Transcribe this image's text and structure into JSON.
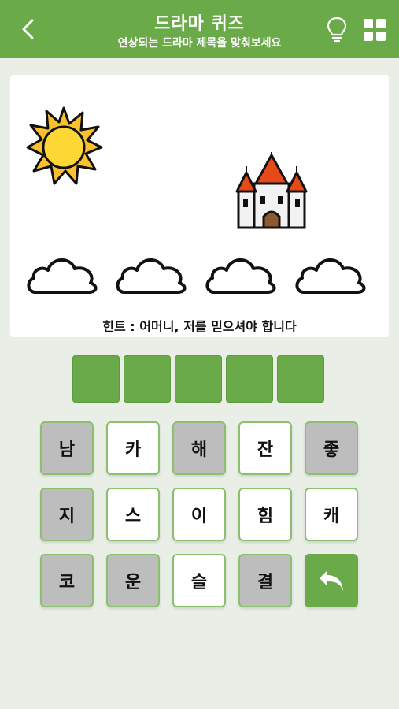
{
  "header": {
    "title": "드라마 퀴즈",
    "subtitle": "연상되는 드라마 제목을 맞춰보세요",
    "back_icon": "back-arrow-icon",
    "hint_icon": "lightbulb-icon",
    "menu_icon": "grid-menu-icon"
  },
  "puzzle": {
    "images": [
      "sun",
      "castle",
      "cloud",
      "cloud",
      "cloud",
      "cloud"
    ],
    "hint": "힌트 : 어머니, 저를 믿으셔야 합니다"
  },
  "answer": {
    "slot_count": 5,
    "slots": [
      "",
      "",
      "",
      "",
      ""
    ]
  },
  "keyboard": {
    "keys": [
      {
        "label": "남",
        "state": "used"
      },
      {
        "label": "카",
        "state": "available"
      },
      {
        "label": "해",
        "state": "used"
      },
      {
        "label": "잔",
        "state": "available"
      },
      {
        "label": "좋",
        "state": "used"
      },
      {
        "label": "지",
        "state": "used"
      },
      {
        "label": "스",
        "state": "available"
      },
      {
        "label": "이",
        "state": "available"
      },
      {
        "label": "힘",
        "state": "available"
      },
      {
        "label": "캐",
        "state": "available"
      },
      {
        "label": "코",
        "state": "used"
      },
      {
        "label": "운",
        "state": "used"
      },
      {
        "label": "슬",
        "state": "available"
      },
      {
        "label": "결",
        "state": "used"
      }
    ],
    "undo_icon": "undo-arrow-icon"
  },
  "colors": {
    "accent": "#6aaa48",
    "background": "#e9efe6",
    "used_key": "#bdbdbd",
    "available_key": "#ffffff"
  }
}
